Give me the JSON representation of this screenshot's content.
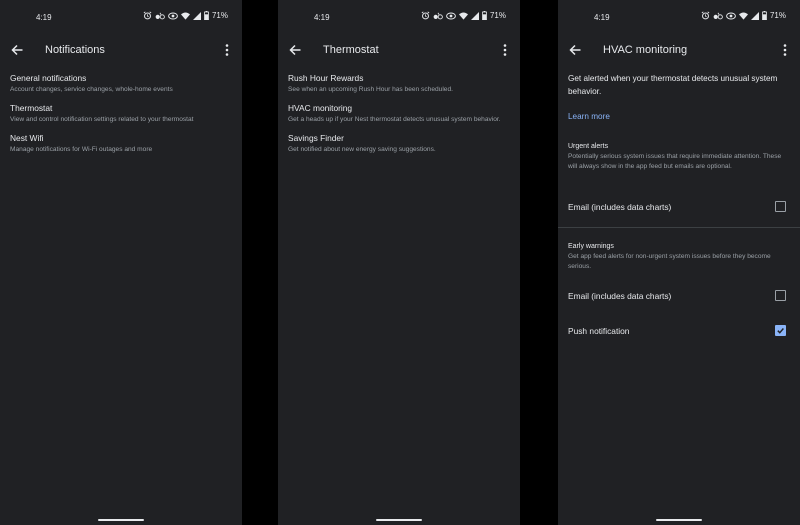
{
  "status": {
    "time": "4:19",
    "battery": "71%"
  },
  "screen1": {
    "title": "Notifications",
    "items": [
      {
        "title": "General notifications",
        "subtitle": "Account changes, service changes, whole-home events"
      },
      {
        "title": "Thermostat",
        "subtitle": "View and control notification settings related to your thermostat"
      },
      {
        "title": "Nest Wifi",
        "subtitle": "Manage notifications for Wi-Fi outages and more"
      }
    ]
  },
  "screen2": {
    "title": "Thermostat",
    "items": [
      {
        "title": "Rush Hour Rewards",
        "subtitle": "See when an upcoming Rush Hour has been scheduled."
      },
      {
        "title": "HVAC monitoring",
        "subtitle": "Get a heads up if your Nest thermostat detects unusual system behavior."
      },
      {
        "title": "Savings Finder",
        "subtitle": "Get notified about new energy saving suggestions."
      }
    ]
  },
  "screen3": {
    "title": "HVAC monitoring",
    "description": "Get alerted when your thermostat detects unusual system behavior.",
    "learn_more": "Learn more",
    "urgent": {
      "heading": "Urgent alerts",
      "description": "Potentially serious system issues that require immediate attention. These will always show in the app feed but emails are optional.",
      "email_label": "Email (includes data charts)",
      "email_checked": false
    },
    "early": {
      "heading": "Early warnings",
      "description": "Get app feed alerts for non-urgent system issues before they become serious.",
      "email_label": "Email (includes data charts)",
      "email_checked": false,
      "push_label": "Push notification",
      "push_checked": true
    }
  },
  "colors": {
    "background": "#202124",
    "accent": "#8ab4f8",
    "text": "#e8eaed",
    "secondary": "#9aa0a6"
  }
}
